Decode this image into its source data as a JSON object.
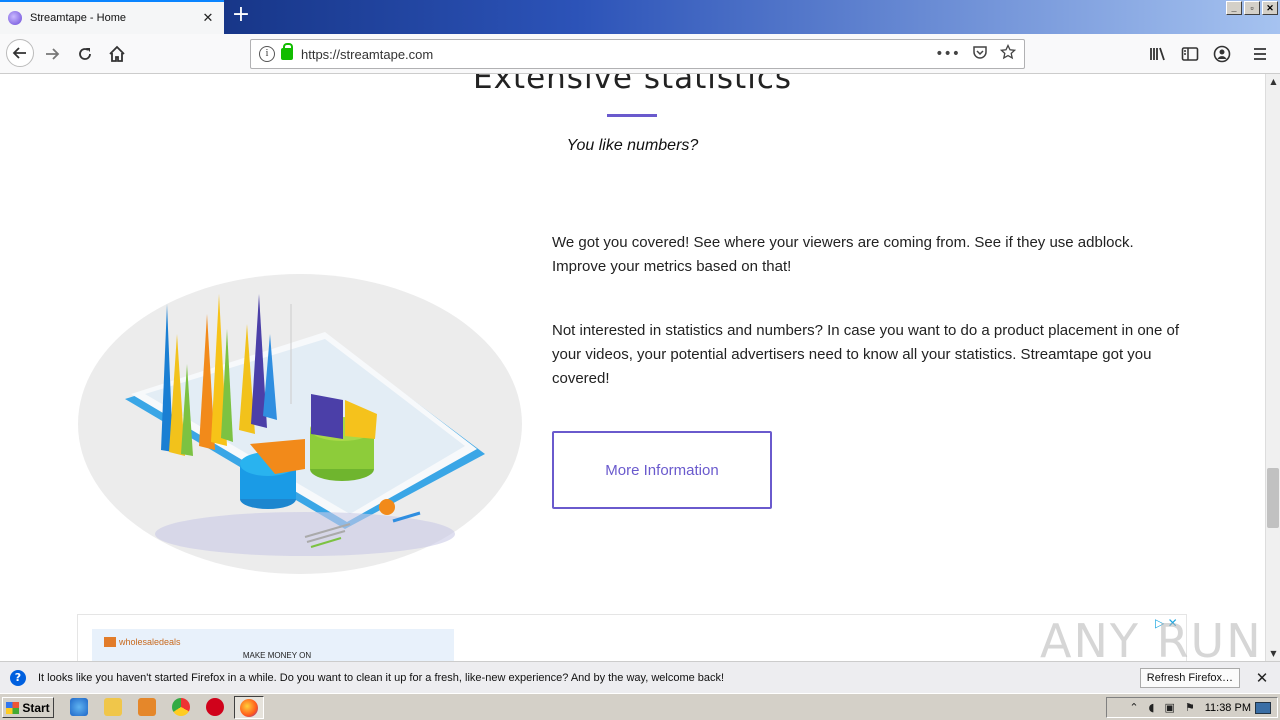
{
  "browser": {
    "tab_title": "Streamtape - Home",
    "tab_close": "✕",
    "new_tab": "+",
    "url": "https://streamtape.com",
    "url_info": "i",
    "page_actions": "•••"
  },
  "window_controls": {
    "minimize": "_",
    "restore": "▫",
    "close": "✕"
  },
  "page": {
    "title": "Extensive statistics",
    "subtitle": "You like numbers?",
    "paragraph1": "We got you covered! See where your viewers are coming from. See if they use adblock. Improve your metrics based on that!",
    "paragraph2": "Not interested in statistics and numbers? In case you want to do a product placement in one of your videos, your potential advertisers need to know all your statistics. Streamtape got you covered!",
    "button": "More Information",
    "accent_color": "#6a5acd"
  },
  "ad": {
    "brand": "wholesaledeals",
    "text": "MAKE MONEY ON",
    "choices": "▷ ✕"
  },
  "watermark": "ANY RUN",
  "notification": {
    "icon": "?",
    "text": "It looks like you haven't started Firefox in a while. Do you want to clean it up for a fresh, like-new experience? And by the way, welcome back!",
    "button": "Refresh Firefox…",
    "close": "✕"
  },
  "taskbar": {
    "start": "Start",
    "clock": "11:38 PM"
  }
}
